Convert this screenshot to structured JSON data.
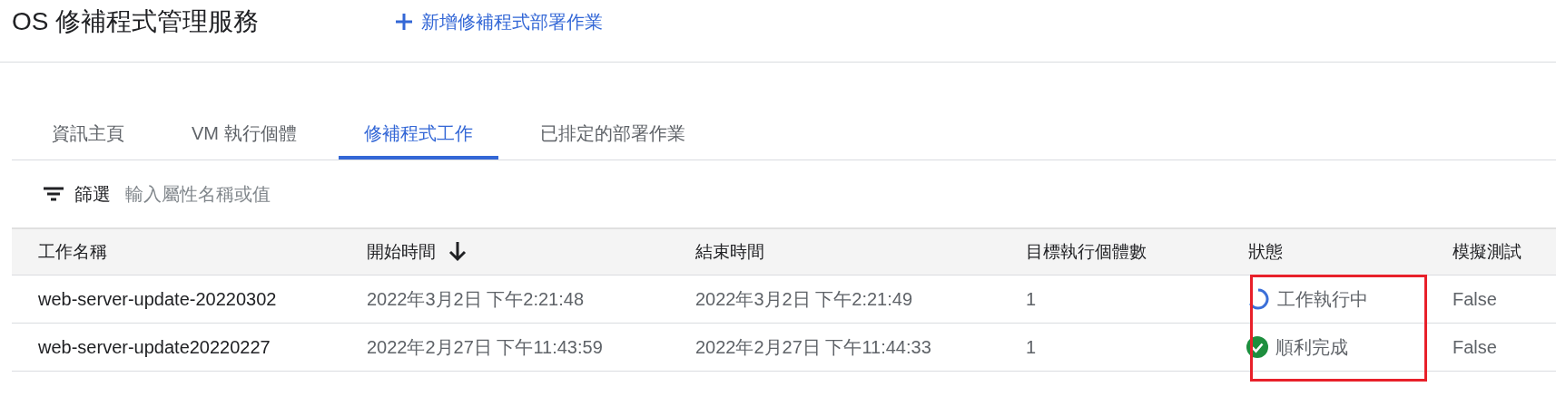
{
  "header": {
    "title": "OS 修補程式管理服務",
    "action": "新增修補程式部署作業"
  },
  "tabs": [
    {
      "label": "資訊主頁",
      "selected": false
    },
    {
      "label": "VM 執行個體",
      "selected": false
    },
    {
      "label": "修補程式工作",
      "selected": true
    },
    {
      "label": "已排定的部署作業",
      "selected": false
    }
  ],
  "filter": {
    "label": "篩選",
    "placeholder": "輸入屬性名稱或值"
  },
  "table": {
    "columns": [
      {
        "label": "工作名稱",
        "sorted": false
      },
      {
        "label": "開始時間",
        "sorted": true
      },
      {
        "label": "結束時間",
        "sorted": false
      },
      {
        "label": "目標執行個體數",
        "sorted": false
      },
      {
        "label": "狀態",
        "sorted": false
      },
      {
        "label": "模擬測試",
        "sorted": false
      }
    ],
    "rows": [
      {
        "name": "web-server-update-20220302",
        "start": "2022年3月2日 下午2:21:48",
        "end": "2022年3月2日 下午2:21:49",
        "targets": "1",
        "status": {
          "kind": "running",
          "label": "工作執行中"
        },
        "dry_run": "False"
      },
      {
        "name": "web-server-update20220227",
        "start": "2022年2月27日 下午11:43:59",
        "end": "2022年2月27日 下午11:44:33",
        "targets": "1",
        "status": {
          "kind": "succeeded",
          "label": "順利完成"
        },
        "dry_run": "False"
      }
    ]
  }
}
